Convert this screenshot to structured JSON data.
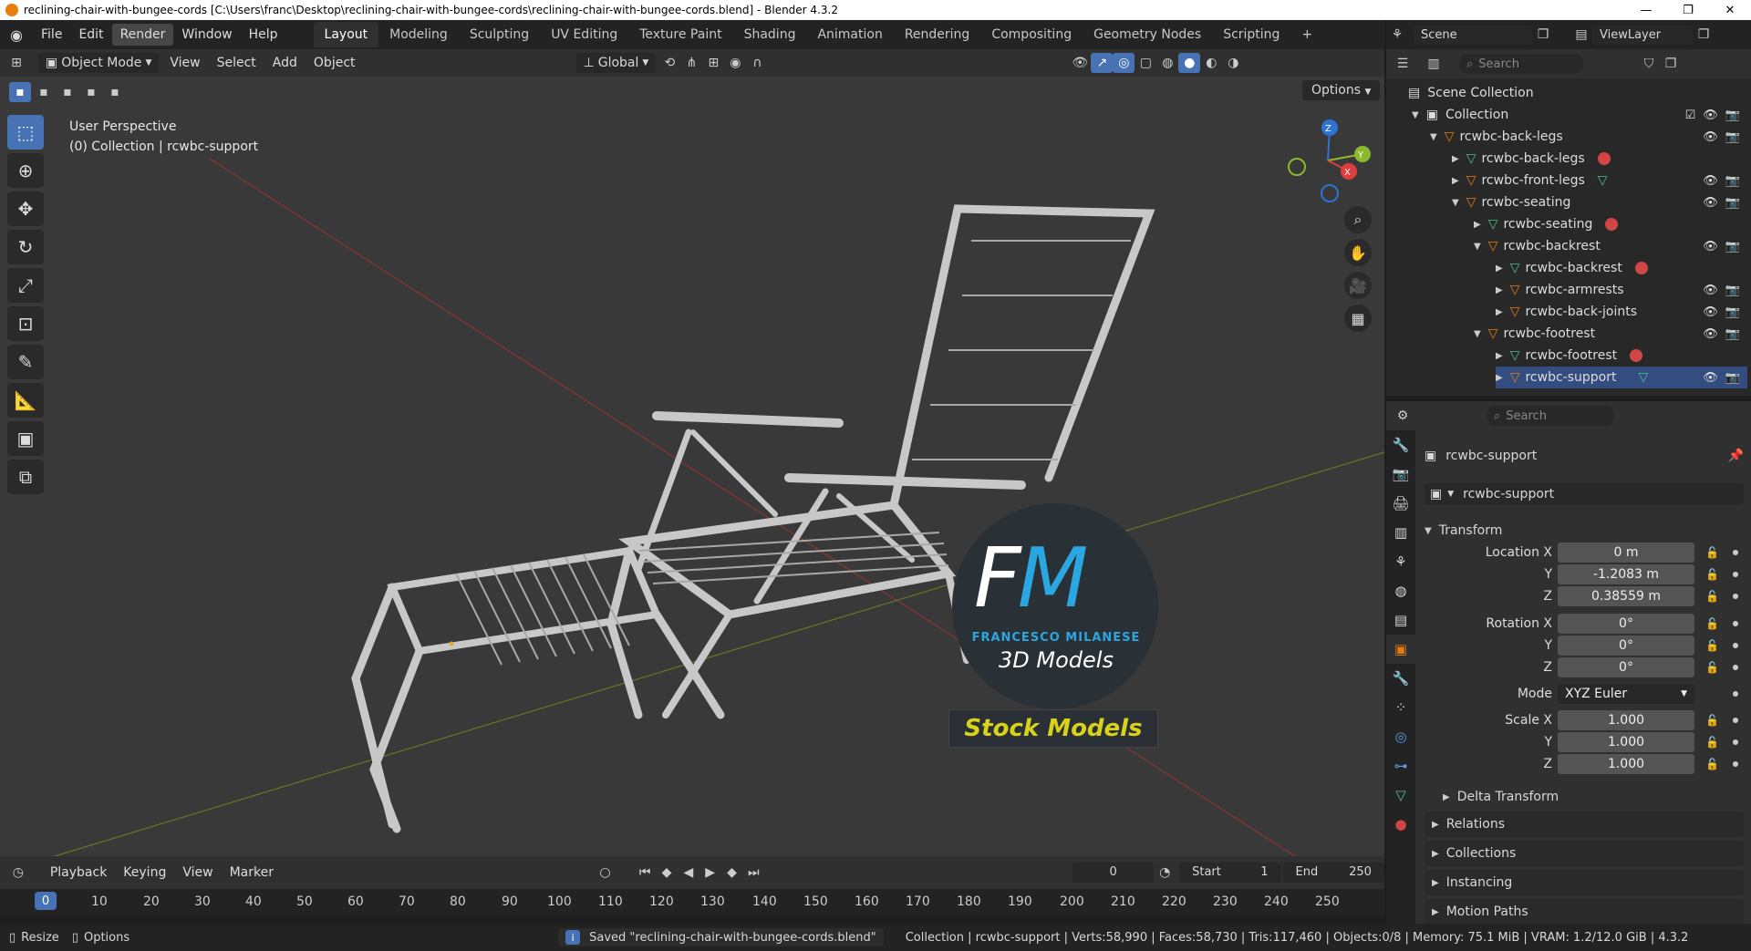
{
  "window": {
    "title": "reclining-chair-with-bungee-cords [C:\\Users\\franc\\Desktop\\reclining-chair-with-bungee-cords\\reclining-chair-with-bungee-cords.blend] - Blender 4.3.2",
    "controls": [
      "—",
      "❐",
      "✕"
    ]
  },
  "menubar": {
    "menus": [
      "File",
      "Edit",
      "Render",
      "Window",
      "Help"
    ],
    "workspaces": [
      "Layout",
      "Modeling",
      "Sculpting",
      "UV Editing",
      "Texture Paint",
      "Shading",
      "Animation",
      "Rendering",
      "Compositing",
      "Geometry Nodes",
      "Scripting"
    ],
    "add_tab": "+"
  },
  "viewport_header": {
    "mode": "Object Mode",
    "menus": [
      "View",
      "Select",
      "Add",
      "Object"
    ],
    "orientation": "Global",
    "options": "Options"
  },
  "viewport": {
    "perspective": "User Perspective",
    "collection_info": "(0) Collection | rcwbc-support",
    "axes": [
      "X",
      "Y",
      "Z"
    ]
  },
  "watermark": {
    "letters_f": "F",
    "letters_m": "M",
    "name": "FRANCESCO MILANESE",
    "sub": "3D Models",
    "stock": "Stock Models"
  },
  "timeline": {
    "menus": [
      "Playback",
      "Keying",
      "View",
      "Marker"
    ],
    "current_frame": "0",
    "start_label": "Start",
    "start": "1",
    "end_label": "End",
    "end": "250",
    "ticks": [
      "0",
      "10",
      "20",
      "30",
      "40",
      "50",
      "60",
      "70",
      "80",
      "90",
      "100",
      "110",
      "120",
      "130",
      "140",
      "150",
      "160",
      "170",
      "180",
      "190",
      "200",
      "210",
      "220",
      "230",
      "240",
      "250"
    ]
  },
  "status": {
    "resize": "Resize",
    "options": "Options",
    "message": "Saved \"reclining-chair-with-bungee-cords.blend\"",
    "stats": "Collection | rcwbc-support | Verts:58,990 | Faces:58,730 | Tris:117,460 | Objects:0/8 | Memory: 75.1 MiB | VRAM: 1.2/12.0 GiB | 4.3.2"
  },
  "scene": {
    "scene_name": "Scene",
    "view_layer": "ViewLayer",
    "search_placeholder": "Search"
  },
  "outliner": {
    "root": "Scene Collection",
    "items": [
      {
        "label": "Collection",
        "depth": 0,
        "kind": "collection"
      },
      {
        "label": "rcwbc-back-legs",
        "depth": 1,
        "kind": "empty"
      },
      {
        "label": "rcwbc-back-legs",
        "depth": 2,
        "kind": "mesh"
      },
      {
        "label": "rcwbc-front-legs",
        "depth": 2,
        "kind": "empty"
      },
      {
        "label": "rcwbc-seating",
        "depth": 2,
        "kind": "empty"
      },
      {
        "label": "rcwbc-seating",
        "depth": 3,
        "kind": "mesh"
      },
      {
        "label": "rcwbc-backrest",
        "depth": 3,
        "kind": "empty"
      },
      {
        "label": "rcwbc-backrest",
        "depth": 4,
        "kind": "mesh"
      },
      {
        "label": "rcwbc-armrests",
        "depth": 4,
        "kind": "empty"
      },
      {
        "label": "rcwbc-back-joints",
        "depth": 4,
        "kind": "empty"
      },
      {
        "label": "rcwbc-footrest",
        "depth": 3,
        "kind": "empty"
      },
      {
        "label": "rcwbc-footrest",
        "depth": 4,
        "kind": "mesh"
      },
      {
        "label": "rcwbc-support",
        "depth": 4,
        "kind": "empty"
      }
    ]
  },
  "properties": {
    "search_placeholder": "Search",
    "object_name": "rcwbc-support",
    "object_field": "rcwbc-support",
    "transform_label": "Transform",
    "location": {
      "label_x": "Location X",
      "x": "0 m",
      "y": "-1.2083 m",
      "z": "0.38559 m"
    },
    "rotation": {
      "label_x": "Rotation X",
      "x": "0°",
      "y": "0°",
      "z": "0°"
    },
    "mode_label": "Mode",
    "mode": "XYZ Euler",
    "scale": {
      "label_x": "Scale X",
      "x": "1.000",
      "y": "1.000",
      "z": "1.000"
    },
    "axis_y": "Y",
    "axis_z": "Z",
    "delta": "Delta Transform",
    "panels": [
      "Relations",
      "Collections",
      "Instancing",
      "Motion Paths"
    ]
  }
}
